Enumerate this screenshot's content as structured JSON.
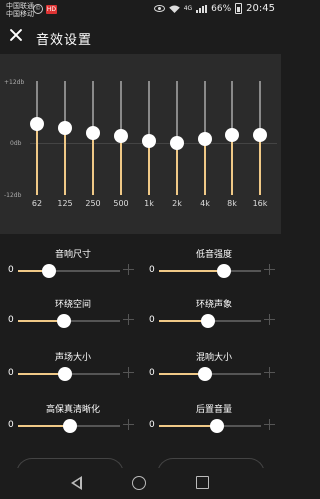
{
  "status_bar": {
    "carrier_1": "中国联通",
    "carrier_2": "中国移动",
    "badge_text": "HD",
    "network": "4G",
    "battery": "66%",
    "time": "20:45"
  },
  "header": {
    "title": "音效设置"
  },
  "equalizer": {
    "scale_top": "+12db",
    "scale_mid": "0db",
    "scale_bottom": "-12db",
    "range_db": [
      -12,
      12
    ],
    "accent": "#f0c987",
    "bands": [
      {
        "label": "62",
        "gain_db": 3.0
      },
      {
        "label": "125",
        "gain_db": 2.2
      },
      {
        "label": "250",
        "gain_db": 1.0
      },
      {
        "label": "500",
        "gain_db": 0.4
      },
      {
        "label": "1k",
        "gain_db": -0.6
      },
      {
        "label": "2k",
        "gain_db": -1.0
      },
      {
        "label": "4k",
        "gain_db": -0.2
      },
      {
        "label": "8k",
        "gain_db": 0.6
      },
      {
        "label": "16k",
        "gain_db": 0.6
      }
    ]
  },
  "sliders": [
    {
      "name": "音响尺寸",
      "min_label": "0",
      "level": 0.3
    },
    {
      "name": "低音强度",
      "min_label": "0",
      "level": 0.64
    },
    {
      "name": "环绕空间",
      "min_label": "0",
      "level": 0.45
    },
    {
      "name": "环绕声象",
      "min_label": "0",
      "level": 0.48
    },
    {
      "name": "声场大小",
      "min_label": "0",
      "level": 0.46
    },
    {
      "name": "混响大小",
      "min_label": "0",
      "level": 0.45
    },
    {
      "name": "高保真清晰化",
      "min_label": "0",
      "level": 0.51
    },
    {
      "name": "后置音量",
      "min_label": "0",
      "level": 0.57
    }
  ],
  "navbar": {
    "icons": [
      "back-icon",
      "home-icon",
      "recents-icon"
    ]
  }
}
